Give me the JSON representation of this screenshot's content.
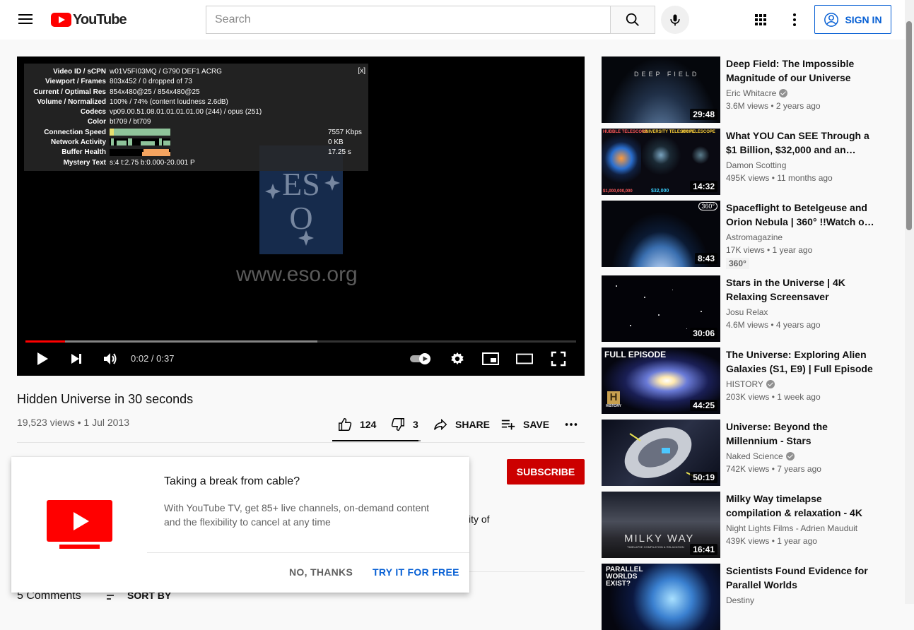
{
  "header": {
    "logo_text": "YouTube",
    "search_placeholder": "Search",
    "signin_label": "SIGN IN"
  },
  "player": {
    "watermark_url": "www.eso.org",
    "watermark_logo_letters": "ESO",
    "time_display": "0:02 / 0:37",
    "progress_played_fraction": 0.072,
    "progress_buffered_fraction": 0.53,
    "stats": {
      "close_label": "[x]",
      "rows": [
        {
          "label": "Video ID / sCPN",
          "value": "w01V5FI03MQ / G790 DEF1 ACRG"
        },
        {
          "label": "Viewport / Frames",
          "value": "803x452 / 0 dropped of 73"
        },
        {
          "label": "Current / Optimal Res",
          "value": "854x480@25 / 854x480@25"
        },
        {
          "label": "Volume / Normalized",
          "value": "100% / 74% (content loudness 2.6dB)"
        },
        {
          "label": "Codecs",
          "value": "vp09.00.51.08.01.01.01.01.00 (244) / opus (251)"
        },
        {
          "label": "Color",
          "value": "bt709 / bt709"
        }
      ],
      "graphs": [
        {
          "label": "Connection Speed",
          "value": "7557 Kbps"
        },
        {
          "label": "Network Activity",
          "value": "0 KB"
        },
        {
          "label": "Buffer Health",
          "value": "17.25 s"
        }
      ],
      "mystery_label": "Mystery Text",
      "mystery_value": "s:4 t:2.75 b:0.000-20.001 P"
    }
  },
  "video": {
    "title": "Hidden Universe in 30 seconds",
    "meta": "19,523 views • 1 Jul 2013",
    "likes": "124",
    "dislikes": "3",
    "share_label": "SHARE",
    "save_label": "SAVE",
    "like_fraction": 0.976,
    "subscribe_label": "SUBSCRIBE",
    "description_fragment": "ity of"
  },
  "comments": {
    "count_label": "5 Comments",
    "sort_label": "SORT BY"
  },
  "promo": {
    "title": "Taking a break from cable?",
    "text": "With YouTube TV, get 85+ live channels, on-demand content and the flexibility to cancel at any time",
    "no_label": "NO, THANKS",
    "try_label": "TRY IT FOR FREE"
  },
  "recommendations": [
    {
      "title": "Deep Field: The Impossible Magnitude of our Universe",
      "channel": "Eric Whitacre",
      "verified": true,
      "meta": "3.6M views • 2 years ago",
      "duration": "29:48",
      "thumb_text": "DEEP FIELD"
    },
    {
      "title": "What YOU Can SEE Through a $1 Billion, $32,000 and an…",
      "channel": "Damon Scotting",
      "verified": false,
      "meta": "495K views • 11 months ago",
      "duration": "14:32",
      "thumb_labels": [
        "HUBBLE TELESCOPE",
        "UNIVERSITY TELESCOPE",
        "MY TELESCOPE",
        "$1,000,000,000",
        "$32,000"
      ]
    },
    {
      "title": "Spaceflight to Betelgeuse and Orion Nebula | 360° !!Watch o…",
      "channel": "Astromagazine",
      "verified": false,
      "meta": "17K views • 1 year ago",
      "duration": "8:43",
      "badge": "360°",
      "thumb_text": "360°"
    },
    {
      "title": "Stars in the Universe | 4K Relaxing Screensaver",
      "channel": "Josu Relax",
      "verified": false,
      "meta": "4.6M views • 4 years ago",
      "duration": "30:06"
    },
    {
      "title": "The Universe: Exploring Alien Galaxies (S1, E9) | Full Episode",
      "channel": "HISTORY",
      "verified": true,
      "meta": "203K views • 1 week ago",
      "duration": "44:25",
      "thumb_text": "FULL EPISODE",
      "thumb_logo": "HISTORY"
    },
    {
      "title": "Universe: Beyond the Millennium - Stars",
      "channel": "Naked Science",
      "verified": true,
      "meta": "742K views • 7 years ago",
      "duration": "50:19"
    },
    {
      "title": "Milky Way timelapse compilation & relaxation - 4K",
      "channel": "Night Lights Films - Adrien Mauduit",
      "verified": false,
      "meta": "439K views • 1 year ago",
      "duration": "16:41",
      "thumb_text": "MILKY WAY",
      "thumb_sub": "TIMELAPSE COMPILATION & RELAXATION"
    },
    {
      "title": "Scientists Found Evidence for Parallel Worlds",
      "channel": "Destiny",
      "verified": false,
      "meta": "",
      "duration": "",
      "thumb_text": "PARALLEL WORLDS EXIST?"
    }
  ],
  "colors": {
    "brand_red": "#ff0000",
    "subscribe_red": "#cc0000",
    "link_blue": "#065fd4"
  }
}
